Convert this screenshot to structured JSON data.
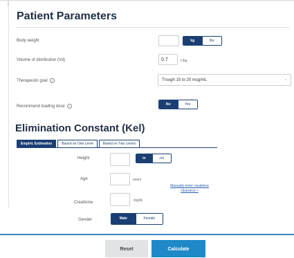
{
  "patient": {
    "title": "Patient Parameters",
    "body_weight": {
      "label": "Body weight",
      "value": "",
      "units": [
        "kg",
        "lbs"
      ],
      "selected": "kg"
    },
    "vd": {
      "label": "Volume of distribution (Vd)",
      "value": "0.7",
      "unit": "L/kg"
    },
    "goal": {
      "label": "Therapeutic goal",
      "selected": "Trough 15 to 20 mcg/mL"
    },
    "loading": {
      "label": "Recommend loading dose",
      "options": [
        "No",
        "Yes"
      ],
      "selected": "No"
    }
  },
  "elimination": {
    "title": "Elimination Constant (Kel)",
    "tabs": [
      "Empiric Estimation",
      "Based on One Level",
      "Based on Two Levels"
    ],
    "active_tab": "Empiric Estimation",
    "height": {
      "label": "Height",
      "value": "",
      "units": [
        "in",
        "cm"
      ],
      "selected": "in"
    },
    "age": {
      "label": "Age",
      "value": "",
      "unit": "years"
    },
    "creatinine": {
      "label": "Creatinine",
      "value": "",
      "unit": "mg/dL"
    },
    "gender": {
      "label": "Gender",
      "options": [
        "Male",
        "Female"
      ],
      "selected": "Male"
    },
    "manual_link": "Manually enter creatinine clearance »"
  },
  "actions": {
    "reset": "Reset",
    "calculate": "Calculate"
  },
  "colors": {
    "primary": "#1b3f73",
    "accent": "#1f89c8",
    "rule": "#3a84c6"
  }
}
